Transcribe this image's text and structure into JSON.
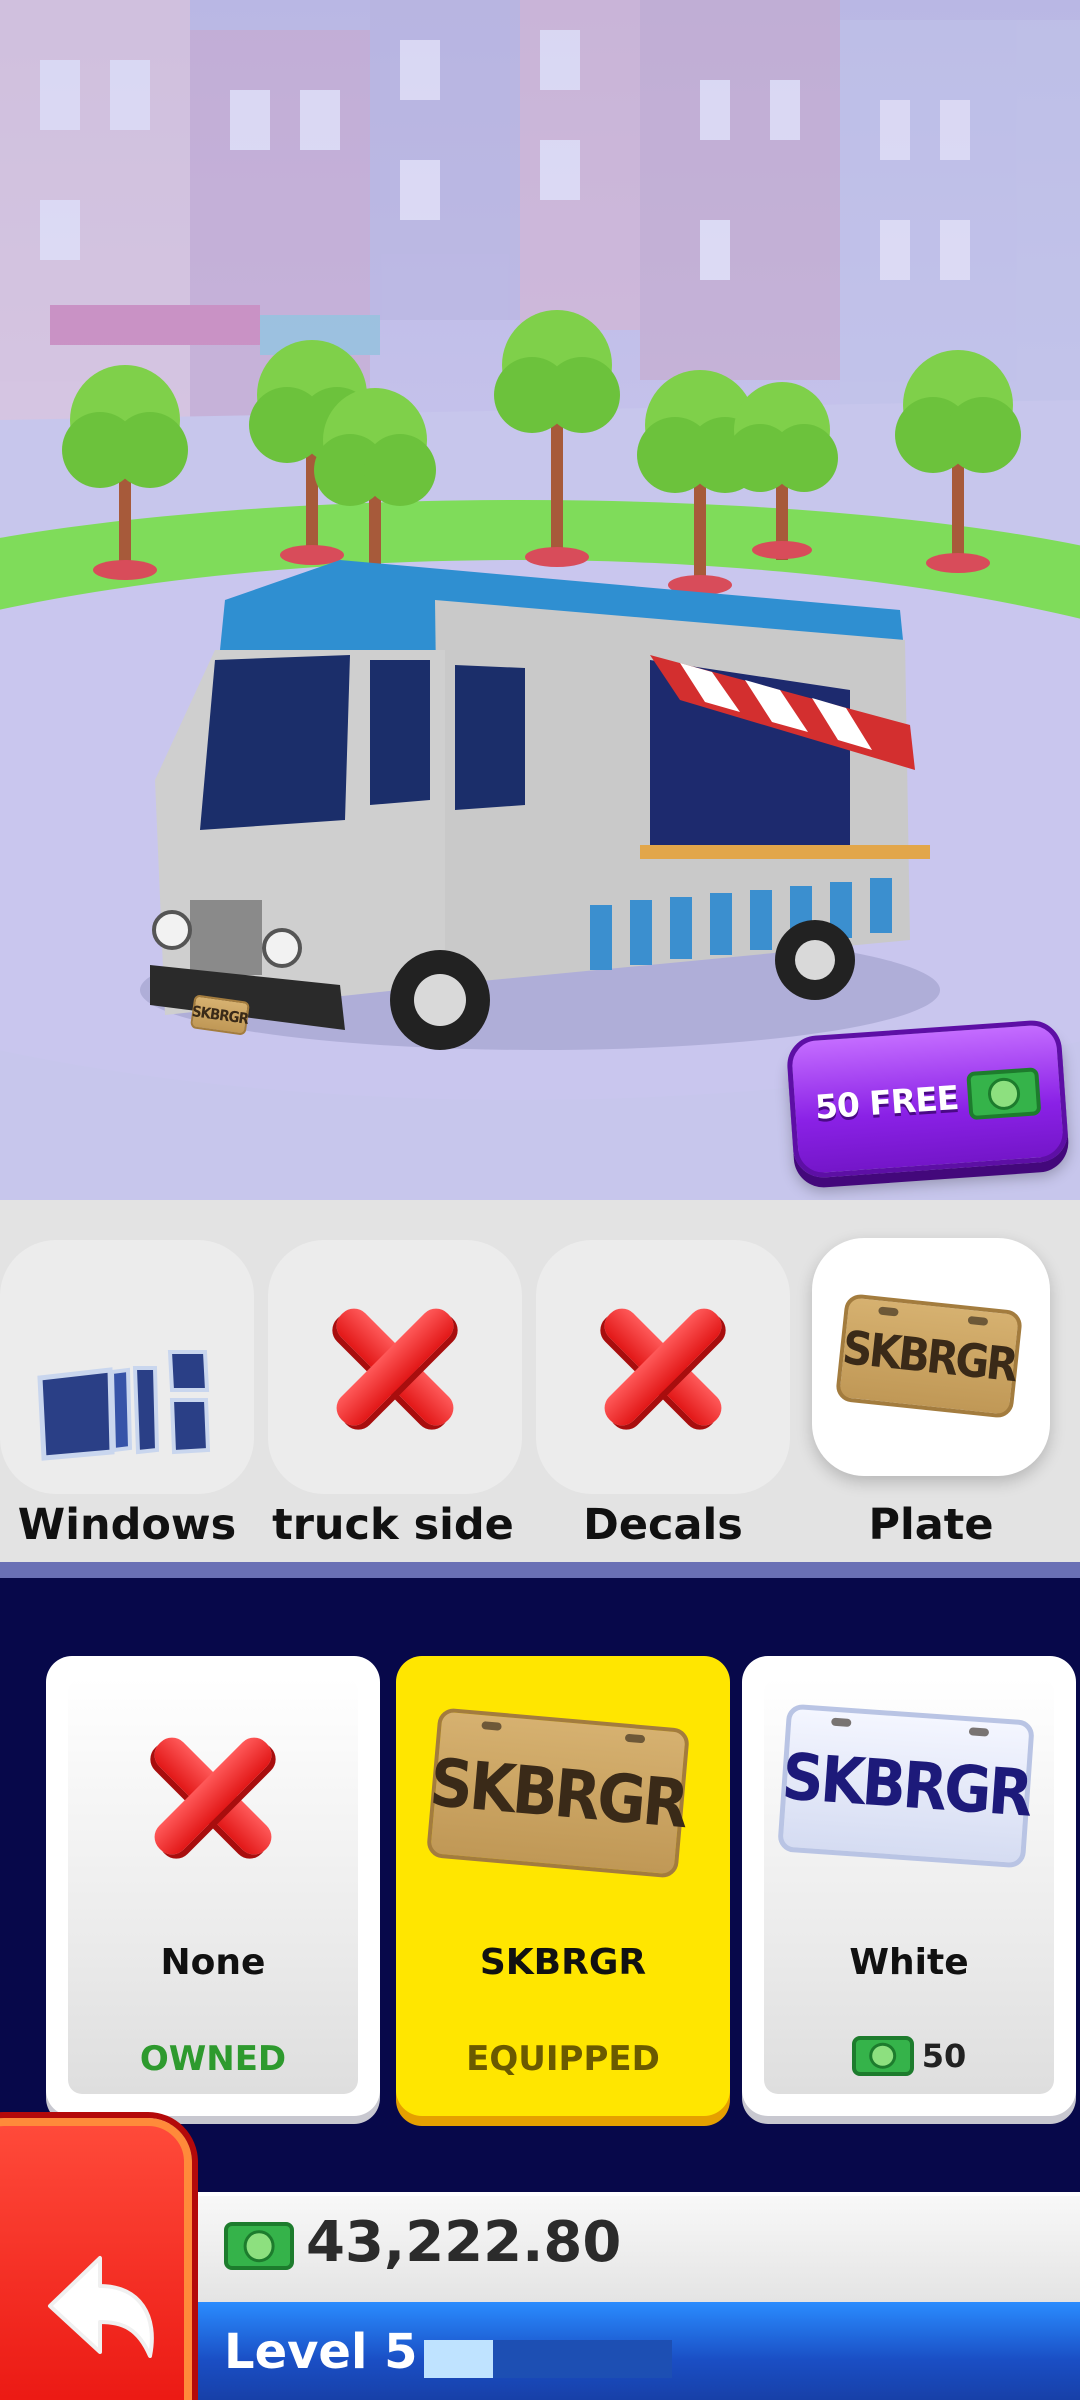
{
  "scene": {
    "truck_plate_text": "SKBRGR",
    "free_offer": {
      "label": "50 FREE",
      "icon": "cash-icon"
    }
  },
  "categories": [
    {
      "label": "Windows",
      "icon": "windows-parts-icon",
      "selected": false
    },
    {
      "label": "truck side",
      "icon": "red-x-icon",
      "selected": false
    },
    {
      "label": "Decals",
      "icon": "red-x-icon",
      "selected": false
    },
    {
      "label": "Plate",
      "icon": "gold-plate-icon",
      "selected": true
    }
  ],
  "items": [
    {
      "name": "None",
      "status": "OWNED",
      "icon": "red-x-icon"
    },
    {
      "name": "SKBRGR",
      "status": "EQUIPPED",
      "icon": "gold-plate-icon",
      "plate_text": "SKBRGR"
    },
    {
      "name": "White",
      "price": "50",
      "icon": "white-plate-icon",
      "plate_text": "SKBRGR"
    }
  ],
  "hud": {
    "cash": "43,222.80",
    "level": "Level 5",
    "level_progress": 0.28
  },
  "colors": {
    "owned": "#2e9a2e",
    "equipped": "#6b5a00",
    "equipped_card": "#ffe600",
    "background": "#07084a"
  }
}
